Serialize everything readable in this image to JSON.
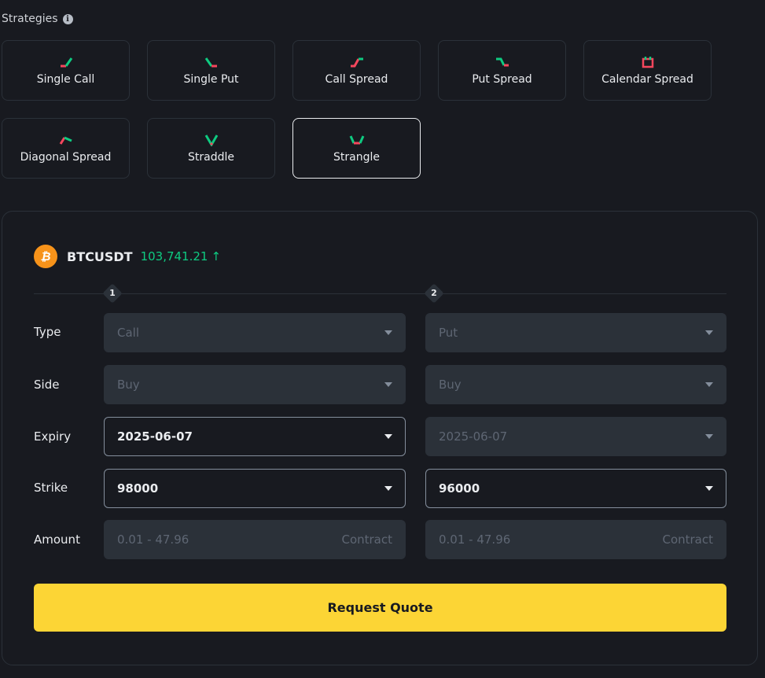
{
  "strategies": {
    "title": "Strategies",
    "items": [
      {
        "label": "Single Call",
        "icon": "single-call-icon"
      },
      {
        "label": "Single Put",
        "icon": "single-put-icon"
      },
      {
        "label": "Call Spread",
        "icon": "call-spread-icon"
      },
      {
        "label": "Put Spread",
        "icon": "put-spread-icon"
      },
      {
        "label": "Calendar Spread",
        "icon": "calendar-spread-icon"
      },
      {
        "label": "Diagonal Spread",
        "icon": "diagonal-spread-icon"
      },
      {
        "label": "Straddle",
        "icon": "straddle-icon"
      },
      {
        "label": "Strangle",
        "icon": "strangle-icon"
      }
    ],
    "selected": "Strangle"
  },
  "ticker": {
    "symbol": "BTCUSDT",
    "price": "103,741.21",
    "coin_glyph": "₿",
    "arrow": "↑"
  },
  "legs": [
    "1",
    "2"
  ],
  "form": {
    "labels": {
      "type": "Type",
      "side": "Side",
      "expiry": "Expiry",
      "strike": "Strike",
      "amount": "Amount"
    },
    "leg1": {
      "type": "Call",
      "side": "Buy",
      "expiry": "2025-06-07",
      "strike": "98000",
      "amount_placeholder": "0.01 - 47.96",
      "amount_unit": "Contract"
    },
    "leg2": {
      "type": "Put",
      "side": "Buy",
      "expiry": "2025-06-07",
      "strike": "96000",
      "amount_placeholder": "0.01 - 47.96",
      "amount_unit": "Contract"
    }
  },
  "request_button": "Request Quote",
  "colors": {
    "up": "#0ecb81",
    "down": "#f6465d",
    "accent": "#fcd535",
    "background": "#181a20"
  }
}
